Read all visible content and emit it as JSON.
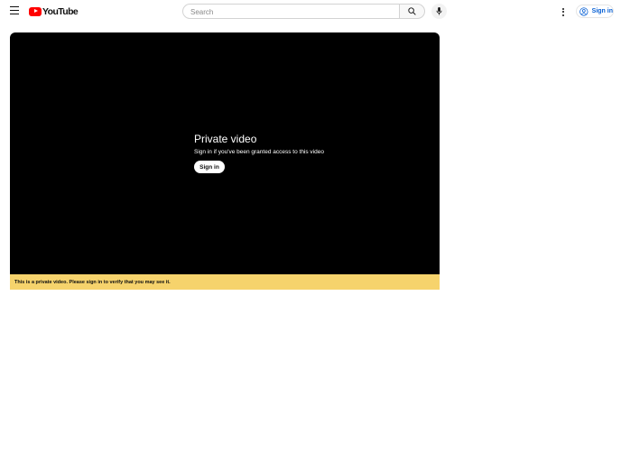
{
  "header": {
    "logo_text": "YouTube",
    "search": {
      "placeholder": "Search",
      "value": ""
    },
    "sign_in_label": "Sign in",
    "icons": {
      "menu": "hamburger-menu-icon",
      "logo": "youtube-logo-icon",
      "search": "search-icon",
      "mic": "microphone-icon",
      "more": "more-vertical-icon",
      "account": "account-circle-icon"
    }
  },
  "player": {
    "title": "Private video",
    "subtitle": "Sign in if you've been granted access to this video",
    "sign_in_label": "Sign in"
  },
  "banner": {
    "text": "This is a private video. Please sign in to verify that you may see it."
  },
  "colors": {
    "brand_red": "#ff0000",
    "link_blue": "#065fd4",
    "banner_yellow": "#f6d36c",
    "player_background": "#000000"
  }
}
